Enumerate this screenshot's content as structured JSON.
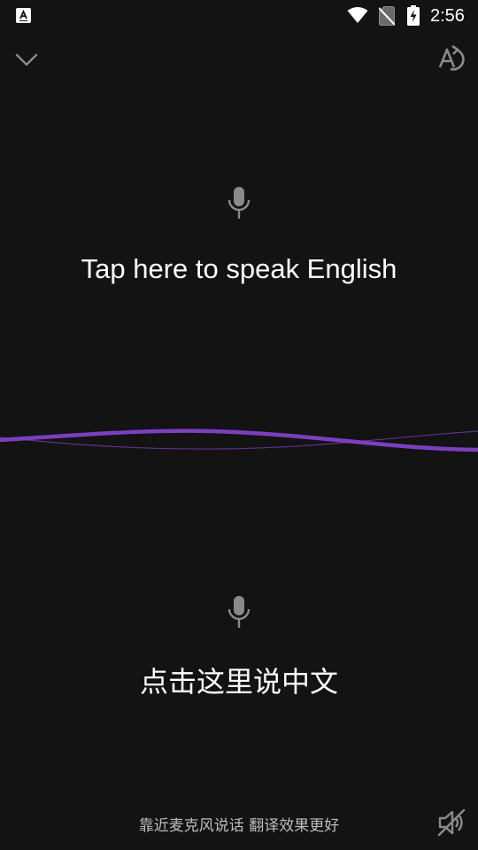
{
  "status_bar": {
    "time": "2:56",
    "icons": [
      "app-notification-icon",
      "wifi-icon",
      "no-sim-icon",
      "battery-charging-icon"
    ]
  },
  "top_bar": {
    "left_icon": "chevron-down-icon",
    "right_icon": "language-swap-icon"
  },
  "panels": {
    "english": {
      "icon": "microphone-icon",
      "prompt": "Tap here to speak English"
    },
    "chinese": {
      "icon": "microphone-icon",
      "prompt": "点击这里说中文"
    }
  },
  "footer": {
    "hint": "靠近麦克风说话 翻译效果更好",
    "right_icon": "speaker-muted-icon"
  },
  "colors": {
    "background": "#131313",
    "wave": "#7b3fbf",
    "icon_gray": "#8a8a8a",
    "text": "#ffffff",
    "hint_text": "#bdbdbd"
  }
}
